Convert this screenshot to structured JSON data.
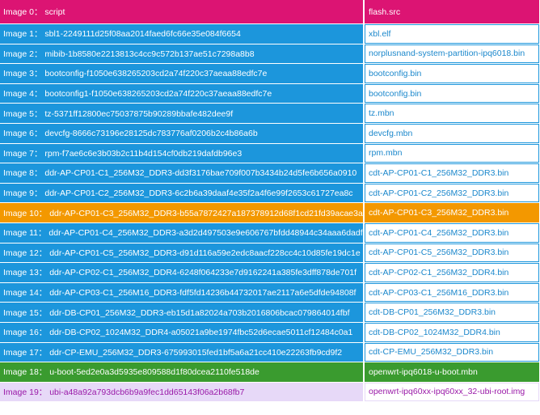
{
  "colors": {
    "header_bg": "#DC1473",
    "blue_bg": "#1C96DC",
    "blue_text_col2": "#1C88CC",
    "orange_bg": "#F39800",
    "green_bg": "#3A9B2F",
    "lavender_bg": "#E7D9F8",
    "purple_text": "#9A1AA8"
  },
  "header": {
    "script": "Image 0： script",
    "flash": "flash.src"
  },
  "rows": [
    {
      "script": "Image 1： sbl1-2249111d25f08aa2014faed6fc66e35e084f6654",
      "flash": "xbl.elf",
      "style": "blue"
    },
    {
      "script": "Image 2： mibib-1b8580e2213813c4cc9c572b137ae51c7298a8b8",
      "flash": "norplusnand-system-partition-ipq6018.bin",
      "style": "blue"
    },
    {
      "script": "Image 3： bootconfig-f1050e638265203cd2a74f220c37aeaa88edfc7e",
      "flash": "bootconfig.bin",
      "style": "blue"
    },
    {
      "script": "Image 4： bootconfig1-f1050e638265203cd2a74f220c37aeaa88edfc7e",
      "flash": "bootconfig.bin",
      "style": "blue"
    },
    {
      "script": "Image 5： tz-5371ff12800ec75037875b90289bbafe482dee9f",
      "flash": "tz.mbn",
      "style": "blue"
    },
    {
      "script": "Image 6： devcfg-8666c73196e28125dc783776af0206b2c4b86a6b",
      "flash": "devcfg.mbn",
      "style": "blue"
    },
    {
      "script": "Image 7： rpm-f7ae6c6e3b03b2c11b4d154cf0db219dafdb96e3",
      "flash": "rpm.mbn",
      "style": "blue"
    },
    {
      "script": "Image 8： ddr-AP-CP01-C1_256M32_DDR3-dd3f3176bae709f007b3434b24d5fe6b656a0910",
      "flash": "cdt-AP-CP01-C1_256M32_DDR3.bin",
      "style": "blue"
    },
    {
      "script": "Image 9： ddr-AP-CP01-C2_256M32_DDR3-6c2b6a39daaf4e35f2a4f6e99f2653c61727ea8c",
      "flash": "cdt-AP-CP01-C2_256M32_DDR3.bin",
      "style": "blue"
    },
    {
      "script": "Image 10： ddr-AP-CP01-C3_256M32_DDR3-b55a7872427a187378912d68f1cd21fd39acae3a",
      "flash": "cdt-AP-CP01-C3_256M32_DDR3.bin",
      "style": "orange"
    },
    {
      "script": "Image 11： ddr-AP-CP01-C4_256M32_DDR3-a3d2d497503e9e606767bfdd48944c34aaa6dadf",
      "flash": "cdt-AP-CP01-C4_256M32_DDR3.bin",
      "style": "blue"
    },
    {
      "script": "Image 12： ddr-AP-CP01-C5_256M32_DDR3-d91d116a59e2edc8aacf228cc4c10d85fe19dc1e",
      "flash": "cdt-AP-CP01-C5_256M32_DDR3.bin",
      "style": "blue"
    },
    {
      "script": "Image 13： ddr-AP-CP02-C1_256M32_DDR4-6248f064233e7d9162241a385fe3dff878de701f",
      "flash": "cdt-AP-CP02-C1_256M32_DDR4.bin",
      "style": "blue"
    },
    {
      "script": "Image 14： ddr-AP-CP03-C1_256M16_DDR3-fdf5fd14236b44732017ae2117a6e5dfde94808f",
      "flash": "cdt-AP-CP03-C1_256M16_DDR3.bin",
      "style": "blue"
    },
    {
      "script": "Image 15： ddr-DB-CP01_256M32_DDR3-eb15d1a82024a703b2016806bcac079864014fbf",
      "flash": "cdt-DB-CP01_256M32_DDR3.bin",
      "style": "blue"
    },
    {
      "script": "Image 16： ddr-DB-CP02_1024M32_DDR4-a05021a9be1974fbc52d6ecae5011cf12484c0a1",
      "flash": "cdt-DB-CP02_1024M32_DDR4.bin",
      "style": "blue"
    },
    {
      "script": "Image 17： ddr-CP-EMU_256M32_DDR3-675993015fed1bf5a6a21cc410e22263fb9cd9f2",
      "flash": "cdt-CP-EMU_256M32_DDR3.bin",
      "style": "blue"
    },
    {
      "script": "Image 18： u-boot-5ed2e0a3d5935e809588d1f80dcea2110fe518de",
      "flash": "openwrt-ipq6018-u-boot.mbn",
      "style": "green"
    },
    {
      "script": "Image 19： ubi-a48a92a793dcb6b9a9fec1dd65143f06a2b68fb7",
      "flash": "openwrt-ipq60xx-ipq60xx_32-ubi-root.img",
      "style": "lavender"
    }
  ]
}
